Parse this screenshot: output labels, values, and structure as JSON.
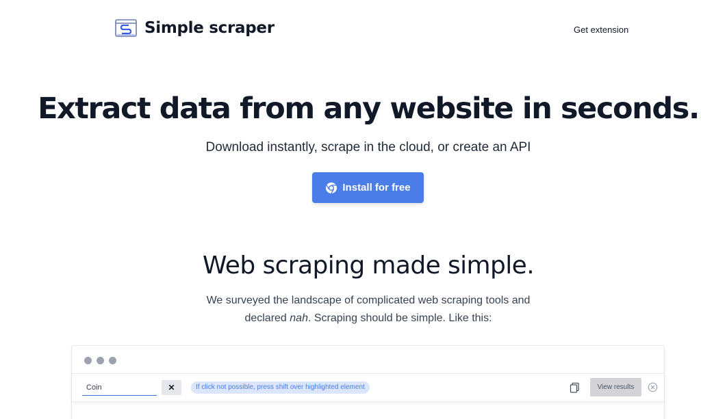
{
  "header": {
    "brand": "Simple scraper",
    "nav_link": "Get extension"
  },
  "hero": {
    "title": "Extract data from any website in seconds.",
    "subtitle": "Download instantly, scrape in the cloud, or create an API",
    "cta_label": "Install for free",
    "cta_icon": "chrome-icon"
  },
  "section": {
    "title": "Web scraping made simple.",
    "text_line1": "We surveyed the landscape of complicated web scraping tools and",
    "text_line2_before": "declared ",
    "text_line2_em": "nah",
    "text_line2_after": ". Scraping should be simple. Like this:"
  },
  "demo": {
    "input_value": "Coin",
    "clear_label": "✕",
    "hint": "If click not possible, press shift over highlighted element",
    "view_results": "View results",
    "icons": [
      "copy-icon",
      "close-circle-icon"
    ]
  },
  "colors": {
    "accent": "#4a7de8",
    "hint_bg": "#dbe5fb",
    "text_dark": "#111827"
  }
}
